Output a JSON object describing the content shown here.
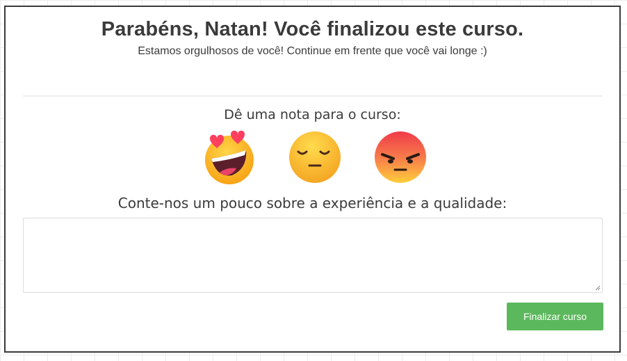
{
  "header": {
    "title": "Parabéns, Natan! Você finalizou este curso.",
    "subtitle": "Estamos orgulhosos de você! Continue em frente que você vai longe :)"
  },
  "rating": {
    "label": "Dê uma nota para o curso:",
    "options": [
      {
        "icon": "heart-eyes-emoji-icon"
      },
      {
        "icon": "unamused-emoji-icon"
      },
      {
        "icon": "angry-emoji-icon"
      }
    ]
  },
  "feedback": {
    "label": "Conte-nos um pouco sobre a experiência e a qualidade:",
    "value": "",
    "placeholder": ""
  },
  "actions": {
    "finish_label": "Finalizar curso"
  },
  "colors": {
    "primary_button": "#5cb85c",
    "text": "#3a3a3a"
  }
}
